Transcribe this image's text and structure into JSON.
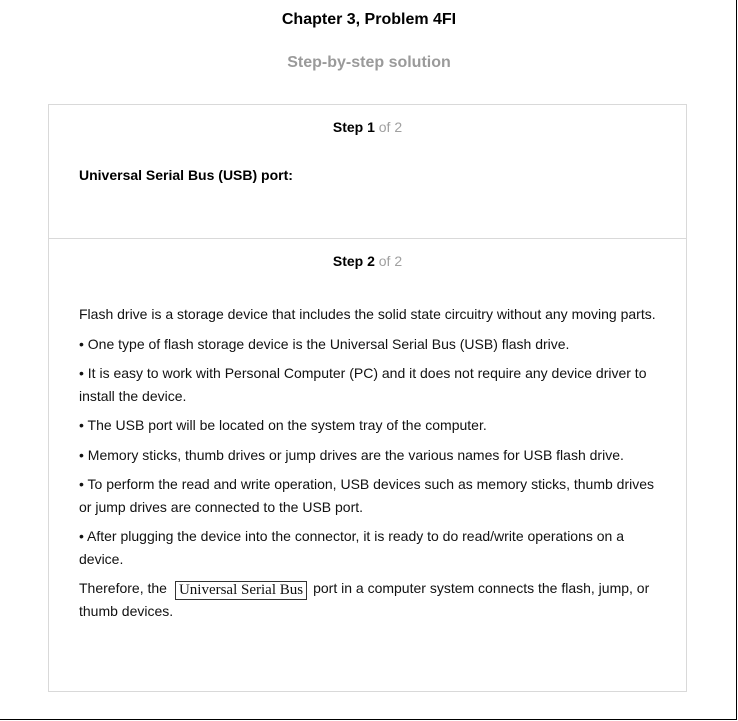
{
  "page": {
    "title": "Chapter 3, Problem 4FI",
    "subtitle": "Step-by-step solution"
  },
  "steps": [
    {
      "label": "Step 1",
      "of_text": "of 2",
      "heading": "Universal Serial Bus (USB) port:"
    },
    {
      "label": "Step 2",
      "of_text": "of 2",
      "paragraphs": [
        "Flash drive is a storage device that includes the solid state circuitry without any moving parts.",
        "• One type of flash storage device is the Universal Serial Bus (USB) flash drive.",
        "• It is easy to work with Personal Computer (PC) and it does not require any device driver to install the device.",
        "• The USB port will be located on the system tray of the computer.",
        "• Memory sticks, thumb drives or jump drives are the various names for USB flash drive.",
        "• To perform the read and write operation, USB devices such as memory sticks, thumb drives or jump drives are connected to the USB port.",
        "• After plugging the device into the connector, it is ready to do read/write operations on a device."
      ],
      "conclusion": {
        "prefix": "Therefore, the",
        "answer": "Universal Serial Bus",
        "suffix": "port in a computer system connects the flash, jump, or thumb devices."
      }
    }
  ]
}
